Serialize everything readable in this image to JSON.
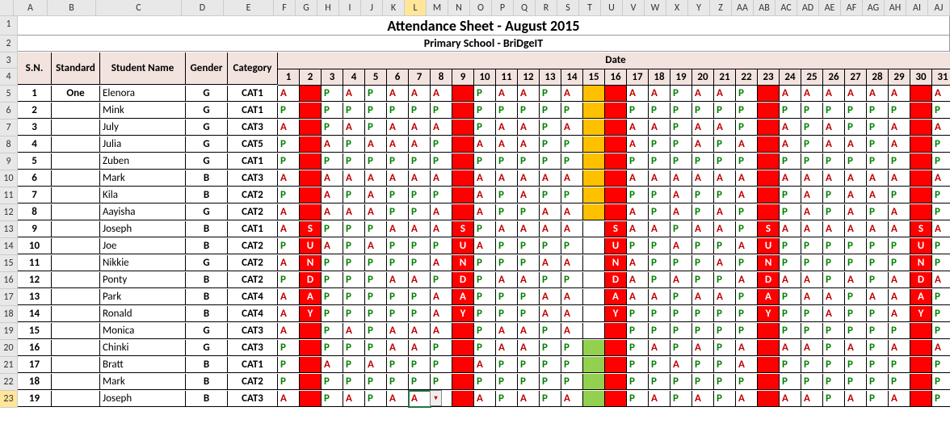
{
  "title": "Attendance Sheet - August 2015",
  "subtitle": "Primary School - BriDgeIT",
  "colLetters": [
    "A",
    "B",
    "C",
    "D",
    "E",
    "F",
    "G",
    "H",
    "I",
    "J",
    "K",
    "L",
    "M",
    "N",
    "O",
    "P",
    "Q",
    "R",
    "S",
    "T",
    "U",
    "V",
    "W",
    "X",
    "Y",
    "Z",
    "AA",
    "AB",
    "AC",
    "AD",
    "AE",
    "AF",
    "AG",
    "AH",
    "AI",
    "AJ"
  ],
  "selectedCol": "L",
  "selectedRow": 23,
  "headers": {
    "sn": "S.N.",
    "standard": "Standard",
    "student": "Student Name",
    "gender": "Gender",
    "category": "Category",
    "date": "Date"
  },
  "days": [
    1,
    2,
    3,
    4,
    5,
    6,
    7,
    8,
    9,
    10,
    11,
    12,
    13,
    14,
    15,
    16,
    17,
    18,
    19,
    20,
    21,
    22,
    23,
    24,
    25,
    26,
    27,
    28,
    29,
    30,
    31
  ],
  "sundayCols": [
    2,
    9,
    16,
    23,
    30
  ],
  "sundayLetters": [
    "S",
    "U",
    "N",
    "D",
    "A",
    "Y"
  ],
  "goldRows": [
    5,
    6,
    7,
    8,
    9,
    10,
    11,
    12
  ],
  "greenRows": [
    20,
    21,
    22,
    23
  ],
  "students": [
    {
      "sn": 1,
      "standard": "One",
      "name": "Elenora",
      "gender": "G",
      "category": "CAT1",
      "att": [
        "A",
        "",
        "P",
        "A",
        "P",
        "A",
        "A",
        "A",
        "",
        "P",
        "A",
        "A",
        "P",
        "A",
        "",
        "",
        "A",
        "A",
        "P",
        "A",
        "A",
        "P",
        "",
        "A",
        "A",
        "A",
        "A",
        "A",
        "A",
        "",
        "A"
      ]
    },
    {
      "sn": 2,
      "standard": "",
      "name": "Mink",
      "gender": "G",
      "category": "CAT1",
      "att": [
        "P",
        "",
        "P",
        "P",
        "P",
        "P",
        "P",
        "P",
        "",
        "P",
        "P",
        "P",
        "P",
        "P",
        "",
        "",
        "P",
        "P",
        "P",
        "P",
        "P",
        "P",
        "",
        "P",
        "P",
        "P",
        "P",
        "P",
        "P",
        "",
        "P"
      ]
    },
    {
      "sn": 3,
      "standard": "",
      "name": "July",
      "gender": "G",
      "category": "CAT3",
      "att": [
        "A",
        "",
        "P",
        "A",
        "P",
        "A",
        "A",
        "A",
        "",
        "P",
        "A",
        "A",
        "P",
        "A",
        "",
        "",
        "A",
        "A",
        "P",
        "A",
        "A",
        "P",
        "",
        "A",
        "P",
        "A",
        "P",
        "P",
        "A",
        "",
        "A"
      ]
    },
    {
      "sn": 4,
      "standard": "",
      "name": "Julia",
      "gender": "G",
      "category": "CAT5",
      "att": [
        "P",
        "",
        "A",
        "P",
        "A",
        "A",
        "A",
        "P",
        "",
        "A",
        "A",
        "A",
        "P",
        "P",
        "",
        "",
        "A",
        "P",
        "P",
        "A",
        "P",
        "A",
        "",
        "A",
        "P",
        "A",
        "A",
        "P",
        "A",
        "",
        "P"
      ]
    },
    {
      "sn": 5,
      "standard": "",
      "name": "Zuben",
      "gender": "G",
      "category": "CAT1",
      "att": [
        "P",
        "",
        "P",
        "P",
        "P",
        "P",
        "P",
        "P",
        "",
        "P",
        "P",
        "P",
        "P",
        "P",
        "",
        "",
        "P",
        "P",
        "P",
        "P",
        "P",
        "P",
        "",
        "P",
        "P",
        "P",
        "P",
        "P",
        "P",
        "",
        "P"
      ]
    },
    {
      "sn": 6,
      "standard": "",
      "name": "Mark",
      "gender": "B",
      "category": "CAT3",
      "att": [
        "A",
        "",
        "A",
        "A",
        "A",
        "A",
        "A",
        "A",
        "",
        "A",
        "A",
        "A",
        "A",
        "A",
        "",
        "",
        "A",
        "A",
        "A",
        "A",
        "A",
        "A",
        "",
        "A",
        "A",
        "A",
        "A",
        "A",
        "A",
        "",
        "A"
      ]
    },
    {
      "sn": 7,
      "standard": "",
      "name": "Kila",
      "gender": "B",
      "category": "CAT2",
      "att": [
        "P",
        "",
        "A",
        "P",
        "A",
        "P",
        "P",
        "P",
        "",
        "A",
        "P",
        "A",
        "P",
        "P",
        "",
        "",
        "P",
        "P",
        "A",
        "P",
        "P",
        "A",
        "",
        "P",
        "A",
        "P",
        "A",
        "A",
        "P",
        "",
        "P"
      ]
    },
    {
      "sn": 8,
      "standard": "",
      "name": "Aayisha",
      "gender": "G",
      "category": "CAT2",
      "att": [
        "A",
        "",
        "A",
        "A",
        "A",
        "P",
        "P",
        "A",
        "",
        "A",
        "P",
        "P",
        "A",
        "A",
        "",
        "",
        "A",
        "P",
        "A",
        "P",
        "A",
        "P",
        "",
        "P",
        "A",
        "P",
        "A",
        "P",
        "A",
        "",
        "P"
      ]
    },
    {
      "sn": 9,
      "standard": "",
      "name": "Joseph",
      "gender": "B",
      "category": "CAT1",
      "att": [
        "A",
        "",
        "P",
        "P",
        "P",
        "A",
        "A",
        "A",
        "",
        "P",
        "A",
        "A",
        "A",
        "A",
        "",
        "",
        "A",
        "A",
        "P",
        "A",
        "A",
        "P",
        "",
        "A",
        "A",
        "A",
        "A",
        "A",
        "A",
        "",
        "A"
      ]
    },
    {
      "sn": 10,
      "standard": "",
      "name": "Joe",
      "gender": "B",
      "category": "CAT2",
      "att": [
        "P",
        "",
        "A",
        "P",
        "A",
        "P",
        "P",
        "P",
        "",
        "A",
        "P",
        "P",
        "P",
        "P",
        "",
        "",
        "P",
        "P",
        "A",
        "P",
        "P",
        "A",
        "",
        "P",
        "P",
        "P",
        "P",
        "P",
        "P",
        "",
        "P"
      ]
    },
    {
      "sn": 11,
      "standard": "",
      "name": "Nikkie",
      "gender": "G",
      "category": "CAT2",
      "att": [
        "A",
        "",
        "P",
        "P",
        "P",
        "P",
        "P",
        "A",
        "",
        "P",
        "P",
        "P",
        "A",
        "A",
        "",
        "",
        "A",
        "P",
        "P",
        "P",
        "A",
        "P",
        "",
        "P",
        "P",
        "P",
        "P",
        "P",
        "P",
        "",
        "P"
      ]
    },
    {
      "sn": 12,
      "standard": "",
      "name": "Ponty",
      "gender": "B",
      "category": "CAT2",
      "att": [
        "P",
        "",
        "P",
        "P",
        "P",
        "A",
        "A",
        "P",
        "",
        "P",
        "A",
        "A",
        "P",
        "P",
        "",
        "",
        "A",
        "P",
        "A",
        "P",
        "P",
        "A",
        "",
        "A",
        "A",
        "P",
        "A",
        "P",
        "A",
        "",
        "A"
      ]
    },
    {
      "sn": 13,
      "standard": "",
      "name": "Park",
      "gender": "B",
      "category": "CAT4",
      "att": [
        "A",
        "",
        "P",
        "P",
        "P",
        "P",
        "P",
        "A",
        "",
        "P",
        "P",
        "P",
        "A",
        "A",
        "",
        "",
        "A",
        "A",
        "P",
        "A",
        "A",
        "P",
        "",
        "P",
        "A",
        "A",
        "P",
        "A",
        "A",
        "",
        "P"
      ]
    },
    {
      "sn": 14,
      "standard": "",
      "name": "Ronald",
      "gender": "B",
      "category": "CAT4",
      "att": [
        "A",
        "",
        "P",
        "P",
        "P",
        "P",
        "P",
        "A",
        "",
        "P",
        "P",
        "P",
        "A",
        "A",
        "",
        "",
        "P",
        "P",
        "P",
        "P",
        "P",
        "P",
        "",
        "P",
        "P",
        "A",
        "P",
        "P",
        "A",
        "",
        "P"
      ]
    },
    {
      "sn": 15,
      "standard": "",
      "name": "Monica",
      "gender": "G",
      "category": "CAT3",
      "att": [
        "A",
        "",
        "P",
        "A",
        "P",
        "A",
        "A",
        "A",
        "",
        "P",
        "A",
        "A",
        "P",
        "A",
        "",
        "",
        "P",
        "P",
        "P",
        "P",
        "P",
        "P",
        "",
        "P",
        "P",
        "P",
        "P",
        "P",
        "P",
        "",
        "P"
      ]
    },
    {
      "sn": 16,
      "standard": "",
      "name": "Chinki",
      "gender": "G",
      "category": "CAT3",
      "att": [
        "P",
        "",
        "P",
        "P",
        "P",
        "A",
        "A",
        "P",
        "",
        "P",
        "A",
        "A",
        "P",
        "P",
        "",
        "",
        "P",
        "A",
        "P",
        "A",
        "P",
        "A",
        "",
        "A",
        "A",
        "P",
        "A",
        "P",
        "A",
        "",
        "A"
      ]
    },
    {
      "sn": 17,
      "standard": "",
      "name": "Bratt",
      "gender": "B",
      "category": "CAT1",
      "att": [
        "P",
        "",
        "A",
        "P",
        "A",
        "P",
        "P",
        "P",
        "",
        "A",
        "P",
        "P",
        "P",
        "P",
        "",
        "",
        "P",
        "P",
        "A",
        "P",
        "P",
        "A",
        "",
        "P",
        "P",
        "P",
        "P",
        "P",
        "P",
        "",
        "P"
      ]
    },
    {
      "sn": 18,
      "standard": "",
      "name": "Mark",
      "gender": "B",
      "category": "CAT2",
      "att": [
        "P",
        "",
        "P",
        "P",
        "P",
        "P",
        "P",
        "P",
        "",
        "P",
        "P",
        "P",
        "P",
        "P",
        "",
        "",
        "P",
        "P",
        "P",
        "P",
        "P",
        "P",
        "",
        "P",
        "P",
        "P",
        "P",
        "P",
        "P",
        "",
        "P"
      ]
    },
    {
      "sn": 19,
      "standard": "",
      "name": "Joseph",
      "gender": "B",
      "category": "CAT3",
      "att": [
        "A",
        "",
        "P",
        "A",
        "P",
        "A",
        "A",
        "A",
        "",
        "A",
        "P",
        "A",
        "P",
        "A",
        "",
        "",
        "P",
        "A",
        "P",
        "A",
        "P",
        "A",
        "",
        "A",
        "A",
        "P",
        "A",
        "P",
        "A",
        "",
        "P"
      ]
    }
  ],
  "dropdown_glyph": "▾"
}
